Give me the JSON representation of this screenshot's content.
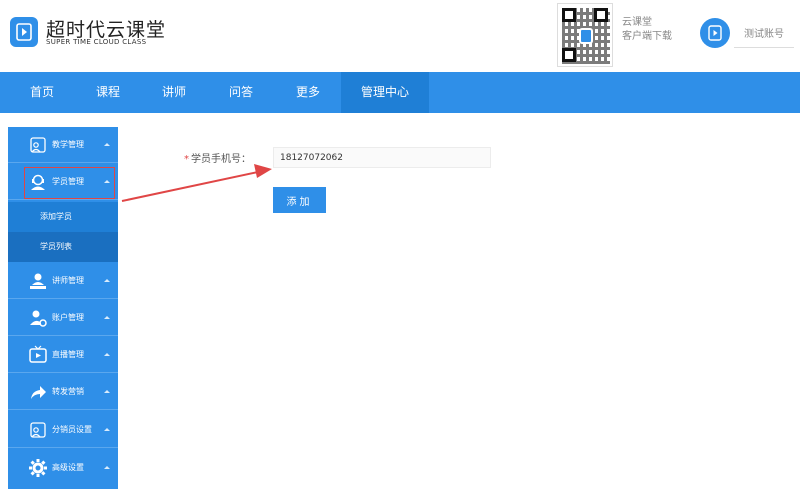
{
  "header": {
    "brand_title": "超时代云课堂",
    "brand_subtitle": "SUPER TIME CLOUD CLASS",
    "qr_line1": "云课堂",
    "qr_line2": "客户端下载",
    "account": "测试账号"
  },
  "nav": {
    "items": [
      {
        "label": "首页"
      },
      {
        "label": "课程"
      },
      {
        "label": "讲师"
      },
      {
        "label": "问答"
      },
      {
        "label": "更多"
      },
      {
        "label": "管理中心"
      }
    ],
    "active_index": 5
  },
  "sidebar": {
    "items": [
      {
        "label": "教学管理",
        "icon": "teaching-icon"
      },
      {
        "label": "学员管理",
        "icon": "student-icon"
      },
      {
        "label": "讲师管理",
        "icon": "teacher-icon"
      },
      {
        "label": "账户管理",
        "icon": "account-settings-icon"
      },
      {
        "label": "直播管理",
        "icon": "live-icon"
      },
      {
        "label": "转发营销",
        "icon": "share-icon"
      },
      {
        "label": "分销员设置",
        "icon": "distributor-icon"
      },
      {
        "label": "高级设置",
        "icon": "gear-icon"
      }
    ],
    "subitems": [
      {
        "label": "添加学员"
      },
      {
        "label": "学员列表"
      }
    ]
  },
  "form": {
    "required_mark": "*",
    "phone_label": "学员手机号：",
    "phone_value": "18127072062",
    "add_button": "添加"
  },
  "colors": {
    "primary": "#2f8fe8",
    "nav_active": "#1f7fd6",
    "sub_active": "#1a6fc0",
    "annotation": "#e04646"
  }
}
